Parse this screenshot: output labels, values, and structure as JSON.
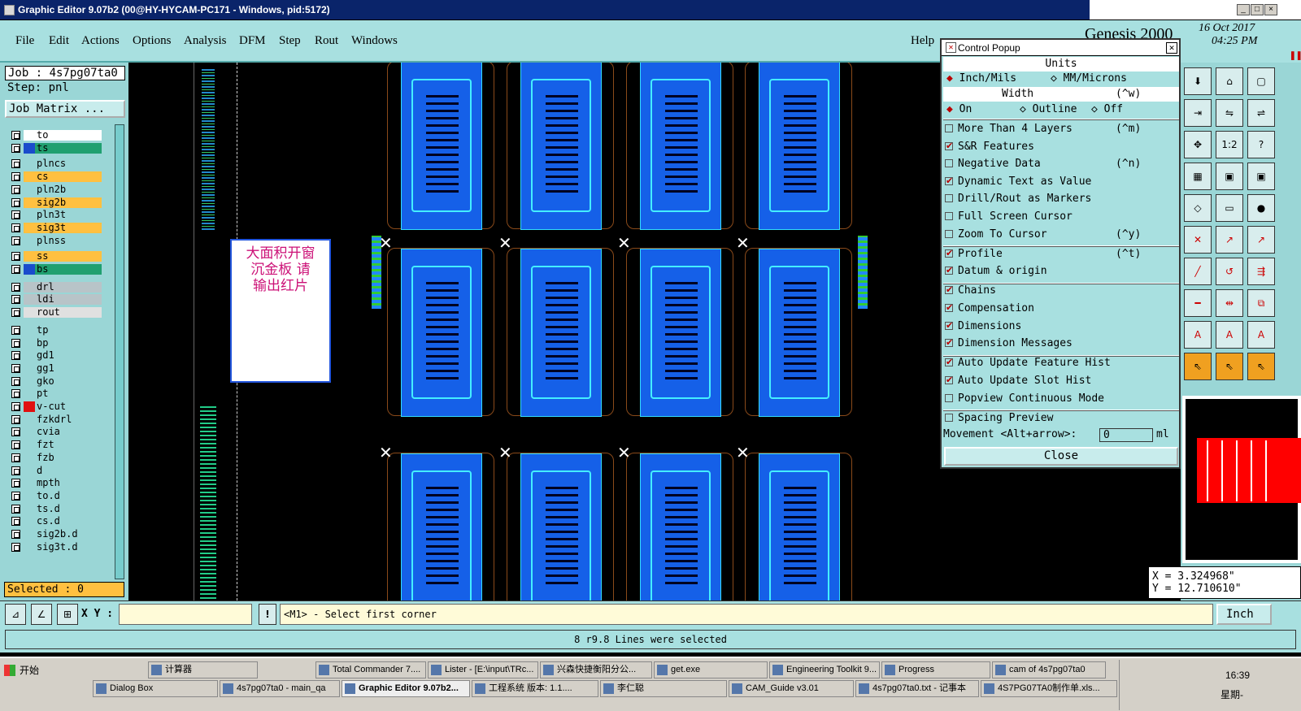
{
  "window": {
    "title": "Graphic Editor 9.07b2 (00@HY-HYCAM-PC171 - Windows, pid:5172)"
  },
  "menu": {
    "items": [
      "File",
      "Edit",
      "Actions",
      "Options",
      "Analysis",
      "DFM",
      "Step",
      "Rout",
      "Windows"
    ],
    "help": "Help"
  },
  "brand": {
    "name": "Genesis 2000",
    "date": "16 Oct 2017",
    "time": "04:25 PM"
  },
  "job": {
    "job_label": "Job : 4s7pg07ta0",
    "step_label": "Step: pnl",
    "matrix_button": "Job Matrix ..."
  },
  "layers": [
    {
      "name": "to",
      "color": "#ffffff"
    },
    {
      "name": "ts",
      "color": "#20a070"
    },
    {
      "name": "plncs",
      "color": "#9ad6d6"
    },
    {
      "name": "cs",
      "color": "#ffc040"
    },
    {
      "name": "pln2b",
      "color": "#9ad6d6"
    },
    {
      "name": "sig2b",
      "color": "#ffc040"
    },
    {
      "name": "pln3t",
      "color": "#9ad6d6"
    },
    {
      "name": "sig3t",
      "color": "#ffc040"
    },
    {
      "name": "plnss",
      "color": "#9ad6d6"
    },
    {
      "name": "ss",
      "color": "#ffc040"
    },
    {
      "name": "bs",
      "color": "#20a070"
    },
    {
      "name": "drl",
      "color": "#b8c4c8"
    },
    {
      "name": "ldi",
      "color": "#b8c4c8"
    },
    {
      "name": "rout",
      "color": "#e0e0e0"
    },
    {
      "name": "tp",
      "color": "#9ad6d6"
    },
    {
      "name": "bp",
      "color": "#9ad6d6"
    },
    {
      "name": "gd1",
      "color": "#9ad6d6"
    },
    {
      "name": "gg1",
      "color": "#9ad6d6"
    },
    {
      "name": "gko",
      "color": "#9ad6d6"
    },
    {
      "name": "pt",
      "color": "#9ad6d6"
    },
    {
      "name": "v-cut",
      "color": "#9ad6d6"
    },
    {
      "name": "fzkdrl",
      "color": "#9ad6d6"
    },
    {
      "name": "cvia",
      "color": "#9ad6d6"
    },
    {
      "name": "fzt",
      "color": "#9ad6d6"
    },
    {
      "name": "fzb",
      "color": "#9ad6d6"
    },
    {
      "name": "d",
      "color": "#9ad6d6"
    },
    {
      "name": "mpth",
      "color": "#9ad6d6"
    },
    {
      "name": "to.d",
      "color": "#9ad6d6"
    },
    {
      "name": "ts.d",
      "color": "#9ad6d6"
    },
    {
      "name": "cs.d",
      "color": "#9ad6d6"
    },
    {
      "name": "sig2b.d",
      "color": "#9ad6d6"
    },
    {
      "name": "sig3t.d",
      "color": "#9ad6d6"
    }
  ],
  "selected": "Selected : 0",
  "note": {
    "line1": "大面积开窗",
    "line2": "沉金板  请",
    "line3": "输出红片"
  },
  "popup": {
    "title": "Control Popup",
    "units_header": "Units",
    "unit_inch": "Inch/Mils",
    "unit_mm": "MM/Microns",
    "width_header": "Width",
    "width_shortcut": "(^w)",
    "width_on": "On",
    "width_outline": "Outline",
    "width_off": "Off",
    "options": [
      {
        "label": "More Than 4 Layers",
        "shortcut": "(^m)",
        "checked": false
      },
      {
        "label": "S&R Features",
        "shortcut": "",
        "checked": true
      },
      {
        "label": "Negative Data",
        "shortcut": "(^n)",
        "checked": false
      },
      {
        "label": "Dynamic Text as Value",
        "shortcut": "",
        "checked": true
      },
      {
        "label": "Drill/Rout as Markers",
        "shortcut": "",
        "checked": false
      },
      {
        "label": "Full Screen Cursor",
        "shortcut": "",
        "checked": false
      },
      {
        "label": "Zoom To Cursor",
        "shortcut": "(^y)",
        "checked": false
      },
      {
        "label": "Profile",
        "shortcut": "(^t)",
        "checked": true
      },
      {
        "label": "Datum & origin",
        "shortcut": "",
        "checked": true
      },
      {
        "label": "Chains",
        "shortcut": "",
        "checked": true
      },
      {
        "label": "Compensation",
        "shortcut": "",
        "checked": true
      },
      {
        "label": "Dimensions",
        "shortcut": "",
        "checked": true
      },
      {
        "label": "Dimension Messages",
        "shortcut": "",
        "checked": true
      },
      {
        "label": "Auto Update Feature Hist",
        "shortcut": "",
        "checked": true
      },
      {
        "label": "Auto Update Slot Hist",
        "shortcut": "",
        "checked": true
      },
      {
        "label": "Popview Continuous Mode",
        "shortcut": "",
        "checked": false
      },
      {
        "label": "Spacing Preview",
        "shortcut": "",
        "checked": false
      }
    ],
    "movement_label": "Movement <Alt+arrow>:",
    "movement_value": "0",
    "movement_unit": "ml",
    "close": "Close"
  },
  "coords": {
    "x": "X = 3.324968\"",
    "y": "Y = 12.710610\""
  },
  "units_button": "Inch",
  "bottom": {
    "xy_label": "X Y :",
    "prompt": "<M1> - Select first corner",
    "status": "8 r9.8 Lines were selected"
  },
  "taskbar": {
    "start": "开始",
    "row1": [
      "计算器",
      "Total Commander 7....",
      "Lister - [E:\\input\\TRc...",
      "兴森快捷衡阳分公...",
      "get.exe",
      "Engineering Toolkit 9...",
      "Progress",
      "cam of 4s7pg07ta0"
    ],
    "row2": [
      "Dialog Box",
      "4s7pg07ta0 - main_qa",
      "Graphic Editor 9.07b2...",
      "工程系统  版本: 1.1....",
      "李仁聪",
      "CAM_Guide v3.01",
      "4s7pg07ta0.txt - 记事本",
      "4S7PG07TA0制作单.xls..."
    ],
    "clock": "16:39",
    "weekday": "星期-"
  }
}
